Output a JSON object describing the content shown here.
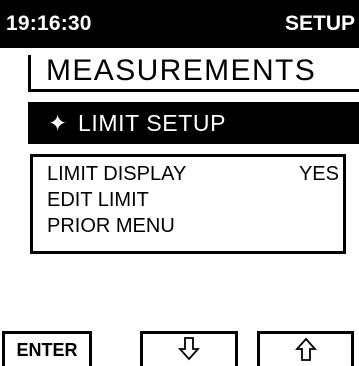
{
  "status_bar": {
    "time": "19:16:30",
    "mode": "SETUP"
  },
  "menu": {
    "title": "MEASUREMENTS",
    "selected": {
      "icon": "four-point-star-icon",
      "icon_glyph": "✦",
      "label": "LIMIT SETUP"
    },
    "options": [
      {
        "label": "LIMIT DISPLAY",
        "value": "YES"
      },
      {
        "label": "EDIT LIMIT",
        "value": ""
      },
      {
        "label": "PRIOR MENU",
        "value": ""
      }
    ]
  },
  "softkeys": {
    "enter_label": "ENTER",
    "down_icon": "down-arrow-icon",
    "up_icon": "up-arrow-icon"
  },
  "colors": {
    "background": "#ffffff",
    "foreground": "#000000"
  }
}
